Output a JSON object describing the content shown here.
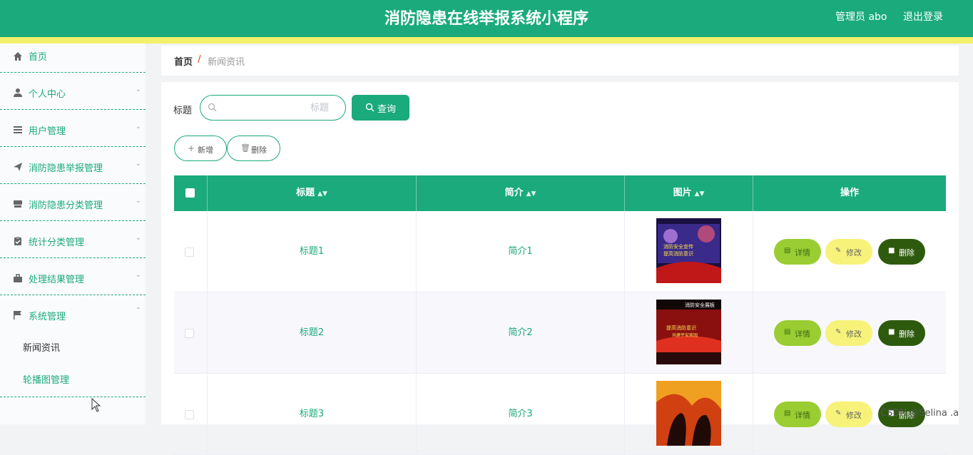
{
  "header": {
    "title": "消防隐患在线举报系统小程序",
    "admin": "管理员 abo",
    "logout": "退出登录"
  },
  "sidebar": {
    "items": [
      {
        "label": "首页",
        "icon": "home-icon"
      },
      {
        "label": "个人中心",
        "icon": "user-icon"
      },
      {
        "label": "用户管理",
        "icon": "list-icon"
      },
      {
        "label": "消防隐患举报管理",
        "icon": "send-icon"
      },
      {
        "label": "消防隐患分类管理",
        "icon": "layers-icon"
      },
      {
        "label": "统计分类管理",
        "icon": "clipboard-icon"
      },
      {
        "label": "处理结果管理",
        "icon": "briefcase-icon"
      },
      {
        "label": "系统管理",
        "icon": "flag-icon"
      }
    ],
    "sub_items": [
      {
        "label": "新闻资讯"
      },
      {
        "label": "轮播图管理"
      }
    ]
  },
  "breadcrumb": {
    "home": "首页",
    "separator": "/",
    "current": "新闻资讯"
  },
  "search": {
    "label": "标题",
    "placeholder": "标题",
    "query_button": "查询"
  },
  "actions": {
    "add": "新增",
    "delete": "删除"
  },
  "table": {
    "columns": [
      "标题",
      "简介",
      "图片",
      "操作"
    ],
    "rows": [
      {
        "title": "标题1",
        "intro": "简介1"
      },
      {
        "title": "标题2",
        "intro": "简介2"
      },
      {
        "title": "标题3",
        "intro": "简介3"
      }
    ],
    "row_actions": {
      "detail": "详情",
      "edit": "修改",
      "delete": "删除"
    }
  },
  "thumb_text": {
    "row1_a": "消防安全宣传",
    "row1_b": "提高消防意识",
    "row2_banner": "消防安全展板",
    "row2_a": "提高消防意识",
    "row2_b": "共建平安家园"
  },
  "watermark": "CSDN @Selina .a",
  "colors": {
    "primary": "#1aaa7b",
    "accent_yellow": "#f4f06b",
    "detail": "#9acd32",
    "edit": "#f7f37a",
    "delete": "#2e5a0e"
  }
}
